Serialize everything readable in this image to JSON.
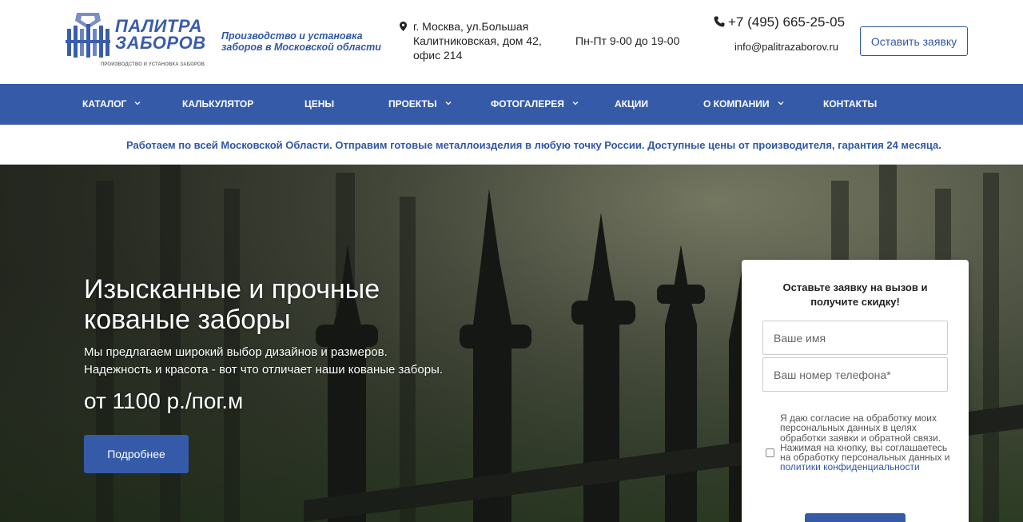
{
  "header": {
    "logo_line1": "ПАЛИТРА",
    "logo_line2": "ЗАБОРОВ",
    "logo_sub": "ПРОИЗВОДСТВО И УСТАНОВКА ЗАБОРОВ",
    "tagline": "Производство и установка заборов в Московской области",
    "address": "г. Москва, ул.Большая Калитниковская, дом 42, офис 214",
    "hours": "Пн-Пт 9-00 до 19-00",
    "phone": "+7 (495) 665-25-05",
    "email": "info@palitrazaborov.ru",
    "request_button": "Оставить заявку"
  },
  "nav": {
    "items": [
      {
        "label": "КАТАЛОГ",
        "has_dropdown": true
      },
      {
        "label": "КАЛЬКУЛЯТОР",
        "has_dropdown": false
      },
      {
        "label": "ЦЕНЫ",
        "has_dropdown": false
      },
      {
        "label": "ПРОЕКТЫ",
        "has_dropdown": true
      },
      {
        "label": "ФОТОГАЛЕРЕЯ",
        "has_dropdown": true
      },
      {
        "label": "АКЦИИ",
        "has_dropdown": false
      },
      {
        "label": "О КОМПАНИИ",
        "has_dropdown": true
      },
      {
        "label": "КОНТАКТЫ",
        "has_dropdown": false
      }
    ]
  },
  "notice": "Работаем по всей Московской Области. Отправим готовые металлоизделия в любую точку России. Доступные цены от производителя, гарантия 24 месяца.",
  "hero": {
    "title": "Изысканные и прочные кованые заборы",
    "subtitle_line1": "Мы предлагаем широкий выбор дизайнов и размеров.",
    "subtitle_line2": "Надежность и красота - вот что отличает наши кованые заборы.",
    "price": "от 1100 р./пог.м",
    "button": "Подробнее"
  },
  "form": {
    "title": "Оставьте заявку на вызов и получите скидку!",
    "name_placeholder": "Ваше имя",
    "phone_placeholder": "Ваш номер телефона*",
    "consent_text": "Я даю согласие на обработку моих персональных данных в целях обработки заявки и обратной связи.",
    "consent_text2": "Нажимая на кнопку, вы соглашаетесь на обработку персональных данных и",
    "consent_link": "политики конфиденциальности",
    "consent_checked": false
  },
  "colors": {
    "brand_blue": "#355aa8",
    "link_blue": "#2f57a8"
  },
  "icons": [
    "logo-emblem-icon",
    "map-pin-icon",
    "phone-icon",
    "chevron-down-icon"
  ]
}
